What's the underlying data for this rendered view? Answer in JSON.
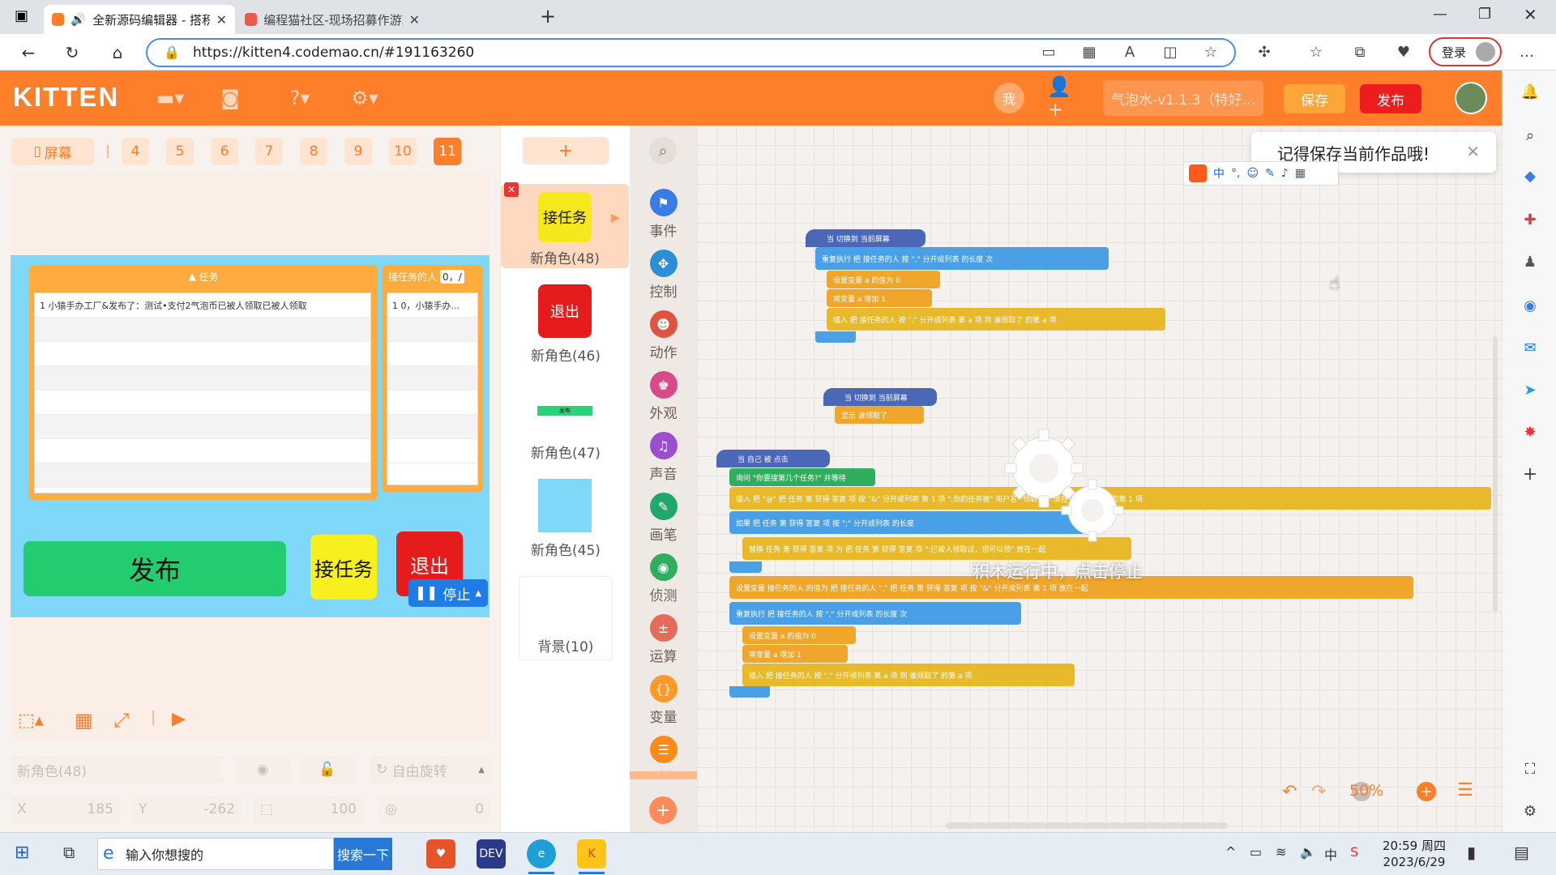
{
  "browser": {
    "tabs": [
      {
        "title": "全新源码编辑器 - 搭积木一"
      },
      {
        "title": "编程猫社区-现场招募作游戏方面"
      }
    ],
    "url": "https://kitten4.codemao.cn/#191163260",
    "login_label": "登录"
  },
  "header": {
    "logo": "KITTEN",
    "me_label": "我",
    "project_name": "气泡水-v1.1.3（特好…",
    "save_label": "保存",
    "publish_label": "发布"
  },
  "scenes": {
    "screen_label": "屏幕",
    "tabs": [
      "4",
      "5",
      "6",
      "7",
      "8",
      "9",
      "10",
      "11"
    ],
    "selected": "11"
  },
  "stage": {
    "list1": {
      "title": "任务",
      "rows": [
        "1  小猿手办工厂&发布了：测试•支付2气泡币已被人领取已被人领取"
      ]
    },
    "list2": {
      "title": "接任务的人",
      "count": "0，/",
      "rows": [
        "1  0，小猿手办..."
      ]
    },
    "publish_btn": "发布",
    "accept_btn": "接任务",
    "quit_btn": "退出"
  },
  "stage_controls": {
    "stop_label": "停止",
    "sprite_name": "新角色(48)",
    "rotation_label": "自由旋转",
    "x_label": "X",
    "x_value": "185",
    "y_label": "Y",
    "y_value": "-262",
    "size_value": "100",
    "direction_value": "0"
  },
  "characters": {
    "add_label": "+",
    "items": [
      {
        "name": "新角色(48)",
        "thumb_text": "接任务",
        "color": "#f7e81e"
      },
      {
        "name": "新角色(46)",
        "thumb_text": "退出",
        "color": "#e61c1c"
      },
      {
        "name": "新角色(47)",
        "thumb_text": "发布",
        "color": "#2bd17b"
      },
      {
        "name": "新角色(45)",
        "thumb_text": "",
        "color": "#7fd8f7"
      },
      {
        "name": "背景(10)",
        "thumb_text": "",
        "color": "#ffffff"
      }
    ]
  },
  "categories": [
    {
      "label": "事件",
      "color": "#3a7be6",
      "icon": "flag-icon"
    },
    {
      "label": "控制",
      "color": "#2a8fd6",
      "icon": "move-icon"
    },
    {
      "label": "动作",
      "color": "#e0533f",
      "icon": "ghost-icon"
    },
    {
      "label": "外观",
      "color": "#d84a8a",
      "icon": "shirt-icon"
    },
    {
      "label": "声音",
      "color": "#9b4fcf",
      "icon": "music-icon"
    },
    {
      "label": "画笔",
      "color": "#1fa86a",
      "icon": "pen-icon"
    },
    {
      "label": "侦测",
      "color": "#2fae5e",
      "icon": "eye-icon"
    },
    {
      "label": "运算",
      "color": "#e26b5a",
      "icon": "math-icon"
    },
    {
      "label": "变量",
      "color": "#ff9a2a",
      "icon": "var-icon"
    },
    {
      "label": "列表",
      "color": "#ff8a1a",
      "icon": "list-icon"
    }
  ],
  "workspace": {
    "toast": "记得保存当前作品哦!",
    "run_overlay": "积木运行中，点击停止",
    "zoom": "50%",
    "blocks": {
      "hat1": "当 切换到 当前屏幕",
      "repeat1": "重复执行  把  接任务的人  按 \",\" 分开成列表 的长度  次",
      "set1": "设置变量  a  的值为  0",
      "inc1": "将变量  a  增加  1",
      "insert1": "插入  把  接任务的人  按 \",\" 分开成列表  第  a  项  到  谁领取了  的第  a  项",
      "hat2": "当 切换到 当前屏幕",
      "show2": "显示  谁领取了",
      "hat3": "当 自己 被 点击",
      "ask3": "询问 \"你要接第几个任务?\" 并等待",
      "insert3": "插入  把 \"@\"  把  任务  第  获得 答复  项  按 \"&\" 分开成列表  第  1  项  \",你的任务被\"  用户名  \"领取啦!\"  放在一起  到  聊天  的第  1  项",
      "if3": "如果  把  任务  第  获得 答复  项  按 \";\" 分开成列表  的长度",
      "replace3": "替换  任务  第  获得 答复  项  为  把  任务  第  获得 答复  项  \";已被人领取过，但可以领\"  放在一起",
      "set3": "设置变量  接任务的人  的值为  把  接任务的人  \",\"  把  任务  第  获得 答复  项  按 \"&\" 分开成列表  第  1  项  放在一起",
      "repeat3": "重复执行  把  接任务的人  按 \",\" 分开成列表 的长度  次",
      "set4": "设置变量  a  的值为  0",
      "inc4": "将变量  a  增加  1",
      "insert4": "插入  把  接任务的人  按 \",\" 分开成列表  第  a  项  到  谁领取了  的第  a  项"
    }
  },
  "taskbar": {
    "search_placeholder": "输入你想搜的",
    "search_button": "搜索一下",
    "time": "20:59 周四",
    "date": "2023/6/29"
  },
  "colors": {
    "brand": "#ff7e2a",
    "publish": "#ee1d1d",
    "stop": "#1f7ce6"
  }
}
